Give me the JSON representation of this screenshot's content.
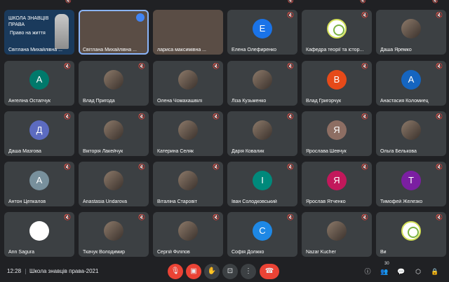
{
  "colors": {
    "background": "#202124",
    "tile": "#3c4043",
    "end_call": "#ea4335",
    "speaking": "#8ab4f8"
  },
  "participants": [
    {
      "name": "Світлана Михайлівна ...",
      "kind": "slide",
      "slide_line1": "ШКОЛА ЗНАВЦІВ",
      "slide_line2": "ПРАВА",
      "slide_line3": "Право на життя",
      "muted": false
    },
    {
      "name": "Світлана Михайлівна ...",
      "kind": "video",
      "muted": false
    },
    {
      "name": "лариса максимівна ...",
      "kind": "video",
      "muted": false
    },
    {
      "name": "Елена Олефиренко",
      "kind": "letter",
      "letter": "Е",
      "color": "#1a73e8",
      "muted": true
    },
    {
      "name": "Кафедра теорії та істор...",
      "kind": "logo",
      "muted": true
    },
    {
      "name": "Даша Яремко",
      "kind": "photo",
      "muted": true
    },
    {
      "name": "Ангеліна Остапчук",
      "kind": "letter",
      "letter": "А",
      "color": "#00796b",
      "muted": true
    },
    {
      "name": "Влад Пригода",
      "kind": "photo",
      "muted": true
    },
    {
      "name": "Олена Чомахашвілі",
      "kind": "photo",
      "muted": true
    },
    {
      "name": "Ліза Кузьменко",
      "kind": "photo",
      "muted": true
    },
    {
      "name": "Влад Григорчук",
      "kind": "letter",
      "letter": "В",
      "color": "#e64a19",
      "muted": true
    },
    {
      "name": "Анастасия Коломиец",
      "kind": "letter",
      "letter": "А",
      "color": "#1565c0",
      "muted": true
    },
    {
      "name": "Даша Мазгова",
      "kind": "letter",
      "letter": "Д",
      "color": "#5c6bc0",
      "muted": true
    },
    {
      "name": "Вікторія Лакейчук",
      "kind": "photo",
      "muted": true
    },
    {
      "name": "Катерина Селяк",
      "kind": "photo",
      "muted": true
    },
    {
      "name": "Дарія Ковалик",
      "kind": "photo",
      "muted": true
    },
    {
      "name": "Ярослава Шевчук",
      "kind": "letter",
      "letter": "Я",
      "color": "#8d6e63",
      "muted": true
    },
    {
      "name": "Ольга Белькова",
      "kind": "photo",
      "muted": true
    },
    {
      "name": "Антон Цепкалов",
      "kind": "letter",
      "letter": "А",
      "color": "#78909c",
      "muted": true
    },
    {
      "name": "Anastasia Undarova",
      "kind": "photo",
      "muted": true
    },
    {
      "name": "Віталіна Старовіт",
      "kind": "photo",
      "muted": true
    },
    {
      "name": "Іван Солодковський",
      "kind": "letter",
      "letter": "І",
      "color": "#00897b",
      "muted": true
    },
    {
      "name": "Ярослав Ятченко",
      "kind": "letter",
      "letter": "Я",
      "color": "#c2185b",
      "muted": true
    },
    {
      "name": "Тимофей Железко",
      "kind": "letter",
      "letter": "Т",
      "color": "#7b1fa2",
      "muted": true
    },
    {
      "name": "Ann Sagura",
      "kind": "photo_white",
      "muted": true
    },
    {
      "name": "Ткачук Володимир",
      "kind": "photo",
      "muted": true
    },
    {
      "name": "Сергій Філіпов",
      "kind": "photo",
      "muted": true
    },
    {
      "name": "Софія Должко",
      "kind": "letter",
      "letter": "С",
      "color": "#1e88e5",
      "muted": true
    },
    {
      "name": "Nazar Kucher",
      "kind": "photo",
      "muted": true
    },
    {
      "name": "Ви",
      "kind": "logo",
      "muted": true
    }
  ],
  "bottom": {
    "time": "12:28",
    "meeting_title": "Школа знавців права-2021",
    "participant_count": "30",
    "controls": {
      "mic_icon": "mic-off-icon",
      "camera_icon": "camera-off-icon",
      "hand_icon": "raise-hand-icon",
      "present_icon": "present-icon",
      "more_icon": "more-vert-icon",
      "end_icon": "call-end-icon"
    }
  }
}
